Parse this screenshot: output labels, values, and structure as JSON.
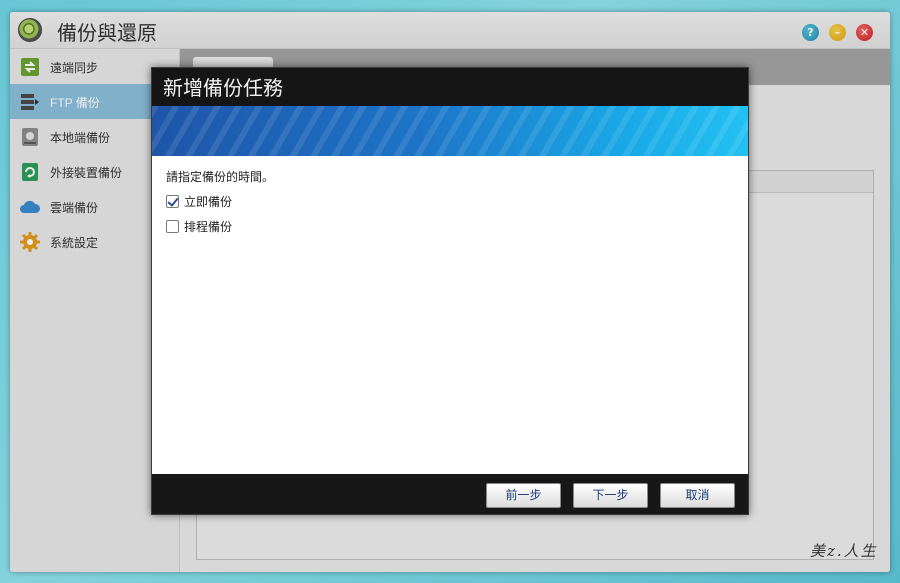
{
  "app": {
    "title": "備份與還原",
    "window_buttons": {
      "help": "?",
      "minimize": "–",
      "close": "✕"
    }
  },
  "sidebar": {
    "items": [
      {
        "label": "遠端同步",
        "icon": "sync-icon",
        "active": false
      },
      {
        "label": "FTP 備份",
        "icon": "ftp-server-icon",
        "active": true
      },
      {
        "label": "本地端備份",
        "icon": "local-disk-icon",
        "active": false
      },
      {
        "label": "外接裝置備份",
        "icon": "external-device-icon",
        "active": false
      },
      {
        "label": "雲端備份",
        "icon": "cloud-icon",
        "active": false
      },
      {
        "label": "系統設定",
        "icon": "gear-icon",
        "active": false
      }
    ]
  },
  "dialog": {
    "title": "新增備份任務",
    "prompt": "請指定備份的時間。",
    "options": [
      {
        "label": "立即備份",
        "checked": true
      },
      {
        "label": "排程備份",
        "checked": false
      }
    ],
    "buttons": {
      "back": "前一步",
      "next": "下一步",
      "cancel": "取消"
    }
  },
  "watermark": "美z.人生",
  "colors": {
    "active_item_bg": "#8bbedb",
    "dialog_title_bg": "#151515",
    "banner_start": "#1e55a8",
    "banner_end": "#23c1f2",
    "button_text": "#1c3c7a"
  }
}
